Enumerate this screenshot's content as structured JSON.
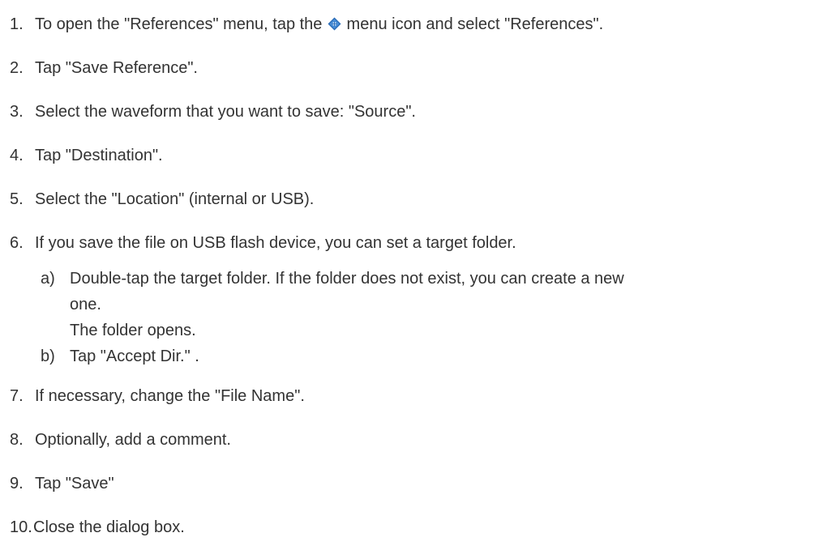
{
  "steps": [
    {
      "num": "1.",
      "before_icon": "To open the \"References\" menu, tap the ",
      "icon": "menu-icon",
      "after_icon": " menu icon and select \"References\"."
    },
    {
      "num": "2.",
      "text": "Tap \"Save Reference\"."
    },
    {
      "num": "3.",
      "text": "Select the waveform that you want to save: \"Source\"."
    },
    {
      "num": "4.",
      "text": "Tap \"Destination\"."
    },
    {
      "num": "5.",
      "text": "Select the \"Location\" (internal or USB)."
    },
    {
      "num": "6.",
      "text": "If you save the file on USB flash device, you can set a target folder."
    },
    {
      "num": "7.",
      "text": "If necessary, change the \"File Name\"."
    },
    {
      "num": "8.",
      "text": "Optionally, add a comment."
    },
    {
      "num": "9.",
      "text": "Tap \"Save\""
    },
    {
      "num": "10.",
      "text": "Close the dialog box."
    }
  ],
  "substeps": [
    {
      "letter": "a)",
      "line1": "Double-tap the target folder. If the folder does not exist, you can create a new",
      "line2": "one.",
      "result": "The folder opens."
    },
    {
      "letter": "b)",
      "text": "Tap \"Accept Dir.\" ."
    }
  ],
  "icon_color": "#1f5fa8"
}
